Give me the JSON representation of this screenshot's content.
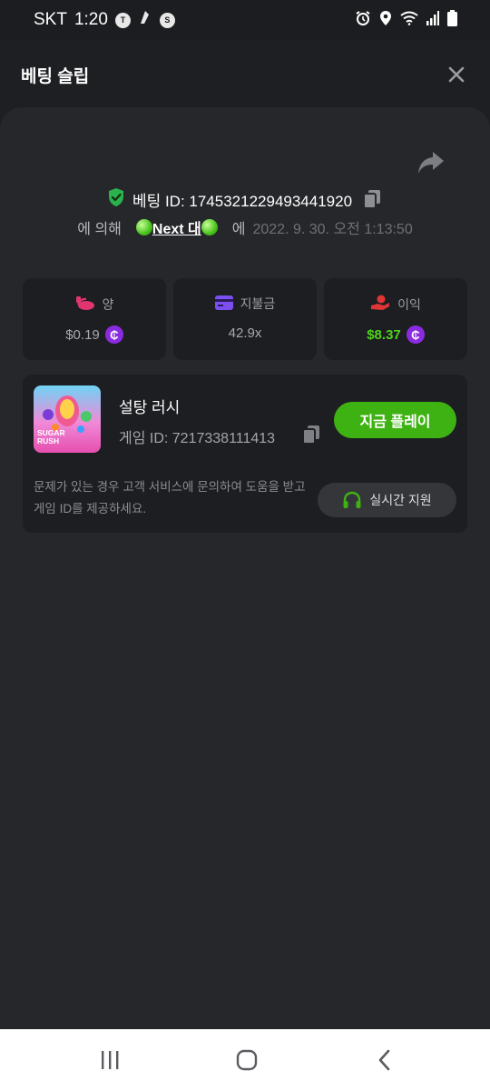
{
  "status_bar": {
    "carrier": "SKT",
    "time": "1:20",
    "left_icons": [
      "talk-icon",
      "custom-notification-icon",
      "s-icon"
    ],
    "right_icons": [
      "alarm-icon",
      "location-icon",
      "wifi-icon",
      "signal-icon",
      "battery-icon"
    ]
  },
  "header": {
    "title": "베팅 슬립",
    "close_icon": "close-icon"
  },
  "bet": {
    "id_text": "베팅 ID: 1745321229493441920",
    "by_label": "에 의해",
    "user": "Next 대",
    "at_label": "에",
    "datetime": "2022. 9. 30. 오전 1:13:50"
  },
  "stats": [
    {
      "label": "양",
      "value": "$0.19",
      "icon": "bet-amount-icon",
      "accent": "#e0356e",
      "coin": true
    },
    {
      "label": "지불금",
      "value": "42.9x",
      "icon": "card-icon",
      "accent": "#7b4ff0",
      "coin": false
    },
    {
      "label": "이익",
      "value": "$8.37",
      "icon": "profit-hand-icon",
      "accent": "#e03535",
      "coin": true,
      "value_color": "#4fd11e"
    }
  ],
  "game": {
    "name": "설탕 러시",
    "id_text": "게임 ID: 7217338111413",
    "thumb_text": "SUGAR RUSH",
    "play_label": "지금 플레이",
    "help_text": "문제가 있는 경우 고객 서비스에 문의하여 도움을 받고 게임 ID를 제공하세요.",
    "support_label": "실시간 지원"
  },
  "coin_symbol": "₵",
  "colors": {
    "play_green": "#3eb212",
    "profit_green": "#4fd11e",
    "shield_green": "#2bb24c",
    "coin_purple": "#8a2be2"
  }
}
